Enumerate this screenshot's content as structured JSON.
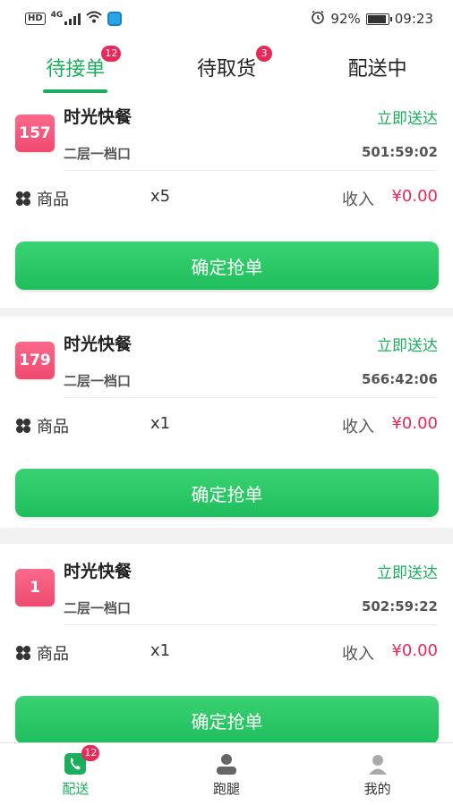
{
  "status_bar": {
    "network_tag": "HD",
    "network_type": "4G",
    "battery": "92%",
    "time": "09:23",
    "icons": [
      "hd-icon",
      "signal-icon",
      "wifi-icon",
      "app-icon",
      "alarm-icon",
      "battery-icon"
    ],
    "battery_level": 0.92
  },
  "tabs": [
    {
      "label": "待接单",
      "badge": "12",
      "active": true
    },
    {
      "label": "待取货",
      "badge": "3",
      "active": false
    },
    {
      "label": "配送中",
      "badge": "",
      "active": false
    }
  ],
  "orders": [
    {
      "number": "157",
      "shop": "时光快餐",
      "delivery": "立即送达",
      "address": "二层一档口",
      "countdown": "501:59:02",
      "goods_label": "商品",
      "quantity": "x5",
      "income_label": "收入",
      "income": "¥0.00",
      "button": "确定抢单"
    },
    {
      "number": "179",
      "shop": "时光快餐",
      "delivery": "立即送达",
      "address": "二层一档口",
      "countdown": "566:42:06",
      "goods_label": "商品",
      "quantity": "x1",
      "income_label": "收入",
      "income": "¥0.00",
      "button": "确定抢单"
    },
    {
      "number": "1",
      "shop": "时光快餐",
      "delivery": "立即送达",
      "address": "二层一档口",
      "countdown": "502:59:22",
      "goods_label": "商品",
      "quantity": "x1",
      "income_label": "收入",
      "income": "¥0.00",
      "button": "确定抢单"
    }
  ],
  "bottom_nav": [
    {
      "label": "配送",
      "badge": "12",
      "icon": "delivery-phone-icon",
      "active": true
    },
    {
      "label": "跑腿",
      "badge": "",
      "icon": "user-icon",
      "active": false
    },
    {
      "label": "我的",
      "badge": "",
      "icon": "profile-icon",
      "active": false
    }
  ],
  "colors": {
    "accent": "#1aae5d",
    "badge": "#e8295a",
    "order_badge": "#f25a7c",
    "button": "#27c462"
  }
}
